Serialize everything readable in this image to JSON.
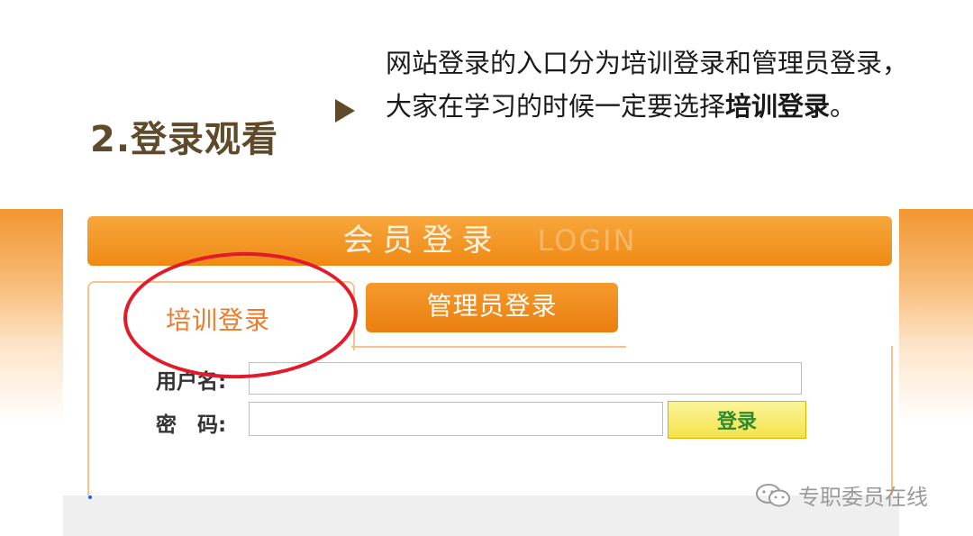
{
  "slide": {
    "title": "2.登录观看",
    "description_line1": "网站登录的入口分为培训登录和管理员登录，",
    "description_line2_prefix": "大家在学习的时候一定要选择",
    "description_line2_bold": "培训登录",
    "description_line2_suffix": "。"
  },
  "login_screen": {
    "header_cn": "会员登录",
    "header_en": "LOGIN",
    "tab_training": "培训登录",
    "tab_admin": "管理员登录",
    "username_label": "用户名:",
    "password_label": "密　码:",
    "username_value": "",
    "password_value": "",
    "login_button": "登录"
  },
  "watermark": {
    "text": "专职委员在线",
    "icon": "wechat-icon"
  },
  "colors": {
    "accent_orange": "#ef8a14",
    "title_brown": "#5f4b2a",
    "highlight_red": "#e21b2b",
    "button_yellow": "#f4e24a"
  }
}
